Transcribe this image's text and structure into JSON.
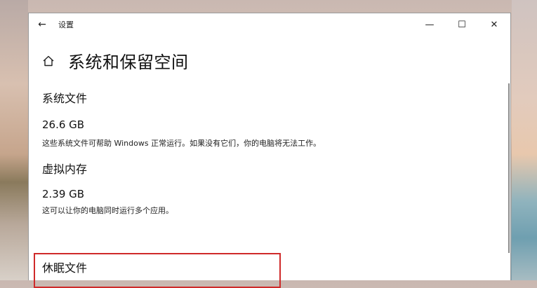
{
  "titlebar": {
    "back_icon": "back-arrow-icon",
    "app_title": "设置",
    "minimize_icon": "minimize-icon",
    "maximize_icon": "maximize-icon",
    "close_icon": "close-icon"
  },
  "header": {
    "home_icon": "home-icon",
    "title": "系统和保留空间"
  },
  "sections": [
    {
      "title": "系统文件",
      "size": "26.6 GB",
      "description": "这些系统文件可帮助 Windows 正常运行。如果没有它们，你的电脑将无法工作。"
    },
    {
      "title": "虚拟内存",
      "size": "2.39 GB",
      "description": "这可以让你的电脑同时运行多个应用。"
    },
    {
      "title": "休眠文件"
    }
  ],
  "colors": {
    "highlight_border": "#cf2a2a",
    "window_bg": "#ffffff"
  }
}
